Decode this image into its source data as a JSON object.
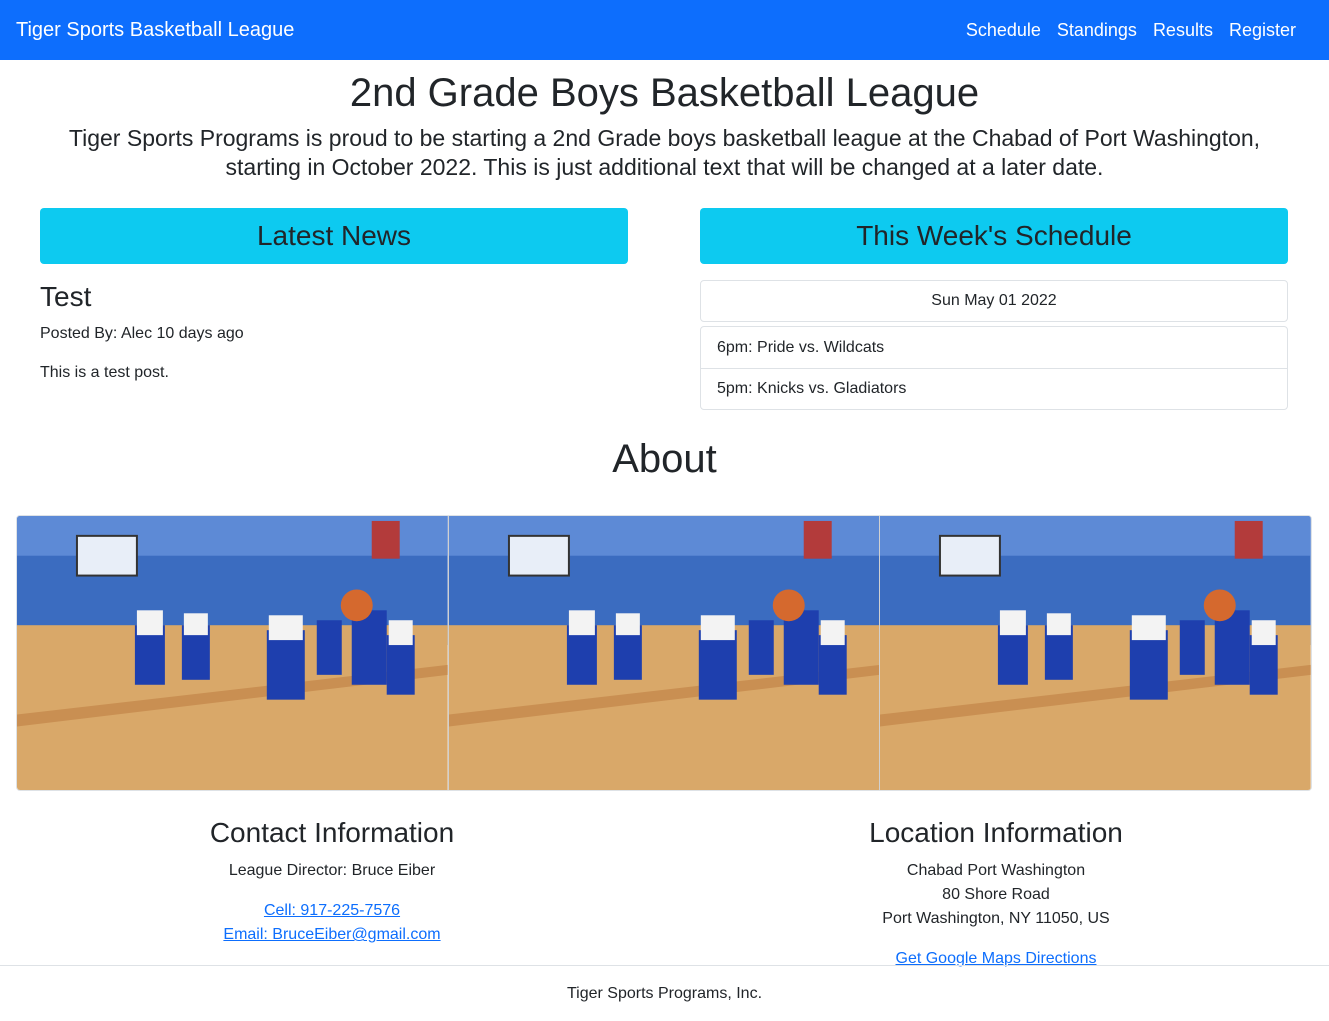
{
  "navbar": {
    "brand": "Tiger Sports Basketball League",
    "links": [
      "Schedule",
      "Standings",
      "Results",
      "Register"
    ]
  },
  "hero": {
    "title": "2nd Grade Boys Basketball League",
    "description": "Tiger Sports Programs is proud to be starting a 2nd Grade boys basketball league at the Chabad of Port Washington, starting in October 2022. This is just additional text that will be changed at a later date."
  },
  "news": {
    "heading": "Latest News",
    "post_title": "Test",
    "post_meta": "Posted By: Alec 10 days ago",
    "post_body": "This is a test post."
  },
  "schedule": {
    "heading": "This Week's Schedule",
    "date": "Sun May 01 2022",
    "games": [
      "6pm: Pride vs. Wildcats",
      "5pm: Knicks vs. Gladiators"
    ]
  },
  "about": {
    "heading": "About"
  },
  "contact": {
    "heading": "Contact Information",
    "director": "League Director: Bruce Eiber",
    "cell": "Cell: 917-225-7576",
    "email": "Email: BruceEiber@gmail.com"
  },
  "location": {
    "heading": "Location Information",
    "name": "Chabad Port Washington",
    "street": "80 Shore Road",
    "city": "Port Washington, NY 11050, US",
    "directions": "Get Google Maps Directions"
  },
  "footer": {
    "text": "Tiger Sports Programs, Inc."
  },
  "colors": {
    "navbar": "#0d6efd",
    "section_header": "#0dcaf0",
    "link": "#0d6efd"
  }
}
